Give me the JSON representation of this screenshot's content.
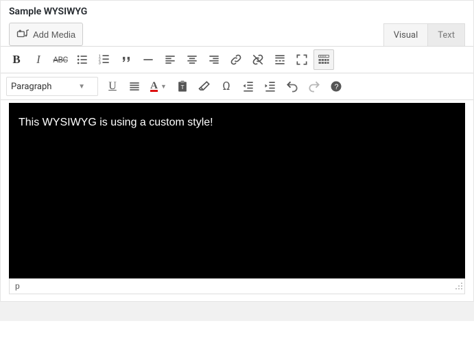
{
  "field": {
    "label": "Sample WYSIWYG"
  },
  "media_button": {
    "label": "Add Media"
  },
  "tabs": {
    "visual": "Visual",
    "text": "Text"
  },
  "format_dropdown": {
    "selected": "Paragraph"
  },
  "editor": {
    "content": "This WYSIWYG is using a custom style!"
  },
  "status": {
    "path": "p"
  },
  "colors": {
    "icon": "#555",
    "editor_bg": "#000000",
    "editor_fg": "#ffffff",
    "textcolor_underline": "#d11"
  }
}
